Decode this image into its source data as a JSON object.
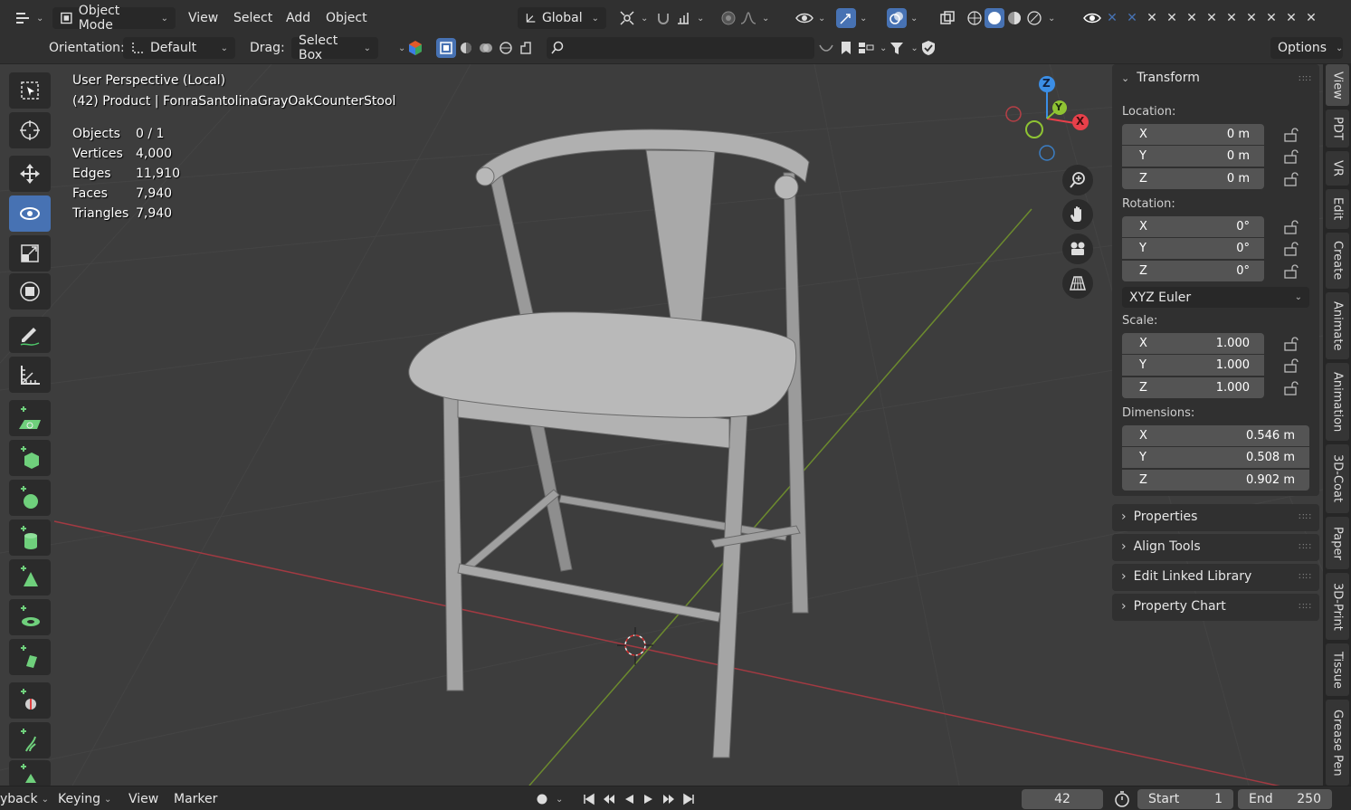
{
  "header": {
    "mode_label": "Object Mode",
    "menus": [
      "View",
      "Select",
      "Add",
      "Object"
    ],
    "transform_orientation": "Global"
  },
  "tool_settings": {
    "orientation_label": "Orientation:",
    "orientation_value": "Default",
    "drag_label": "Drag:",
    "drag_value": "Select Box",
    "options_label": "Options"
  },
  "viewport": {
    "view_name": "User Perspective (Local)",
    "object_line": "(42) Product | FonraSantolinaGrayOakCounterStool",
    "stats": [
      {
        "label": "Objects",
        "value": "0 / 1"
      },
      {
        "label": "Vertices",
        "value": "4,000"
      },
      {
        "label": "Edges",
        "value": "11,910"
      },
      {
        "label": "Faces",
        "value": "7,940"
      },
      {
        "label": "Triangles",
        "value": "7,940"
      }
    ],
    "gizmo_axes": [
      "Z",
      "Y",
      "X"
    ]
  },
  "npanel": {
    "transform_title": "Transform",
    "location_label": "Location:",
    "location": [
      {
        "axis": "X",
        "value": "0 m"
      },
      {
        "axis": "Y",
        "value": "0 m"
      },
      {
        "axis": "Z",
        "value": "0 m"
      }
    ],
    "rotation_label": "Rotation:",
    "rotation": [
      {
        "axis": "X",
        "value": "0°"
      },
      {
        "axis": "Y",
        "value": "0°"
      },
      {
        "axis": "Z",
        "value": "0°"
      }
    ],
    "rotation_mode": "XYZ Euler",
    "scale_label": "Scale:",
    "scale": [
      {
        "axis": "X",
        "value": "1.000"
      },
      {
        "axis": "Y",
        "value": "1.000"
      },
      {
        "axis": "Z",
        "value": "1.000"
      }
    ],
    "dimensions_label": "Dimensions:",
    "dimensions": [
      {
        "axis": "X",
        "value": "0.546 m"
      },
      {
        "axis": "Y",
        "value": "0.508 m"
      },
      {
        "axis": "Z",
        "value": "0.902 m"
      }
    ],
    "collapsed_panels": [
      "Properties",
      "Align Tools",
      "Edit Linked Library",
      "Property Chart"
    ]
  },
  "side_tabs": [
    "View",
    "PDT",
    "VR",
    "Edit",
    "Create",
    "Animate",
    "Animation",
    "3D-Coat",
    "Paper",
    "3D-Print",
    "Tissue",
    "Grease Pen"
  ],
  "timeline": {
    "playback_label": "yback",
    "keying_label": "Keying",
    "view_label": "View",
    "marker_label": "Marker",
    "current_frame": "42",
    "start_label": "Start",
    "start_value": "1",
    "end_label": "End",
    "end_value": "250"
  },
  "colors": {
    "accent": "#4772b3",
    "axis_x": "#e8404a",
    "axis_y": "#8fc433",
    "axis_z": "#3b8ee6"
  }
}
